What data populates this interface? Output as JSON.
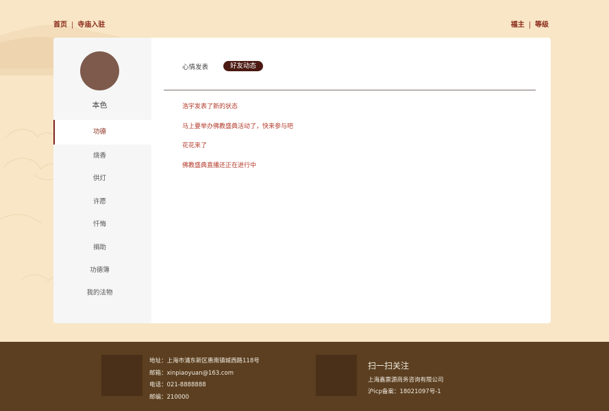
{
  "topnav": {
    "left": [
      {
        "label": "首页"
      },
      {
        "label": "寺庙入驻"
      }
    ],
    "right": [
      {
        "label": "福主"
      },
      {
        "label": "等级"
      }
    ],
    "separator": "|"
  },
  "profile": {
    "name": "本色"
  },
  "sidebar": {
    "items": [
      {
        "label": "功德",
        "active": true
      },
      {
        "label": "烧香"
      },
      {
        "label": "供灯"
      },
      {
        "label": "许愿"
      },
      {
        "label": "忏悔"
      },
      {
        "label": "捐助"
      },
      {
        "label": "功德簿"
      },
      {
        "label": "我的法物"
      }
    ]
  },
  "tabs": [
    {
      "label": "心情发表",
      "active": false
    },
    {
      "label": "好友动态",
      "active": true
    }
  ],
  "feed": [
    "浩宇发表了新的状态",
    "马上要举办佛教盛典活动了，快来参与吧",
    "花花来了",
    "佛教盛典直播还正在进行中"
  ],
  "footer": {
    "address": "地址：上海市浦东新区惠南镇城西路118号",
    "email": "邮箱：xinpiaoyuan@163.com",
    "phone": "电话：021-8888888",
    "postcode": "邮编：210000",
    "follow_title": "扫一扫关注",
    "company": "上海鑫票源商务咨询有限公司",
    "icp": "沪icp备案：18021097号-1"
  },
  "colors": {
    "background": "#f8e6c6",
    "accent": "#8a2a1a",
    "tab_active": "#4b1a12",
    "footer": "#5b3f20"
  }
}
